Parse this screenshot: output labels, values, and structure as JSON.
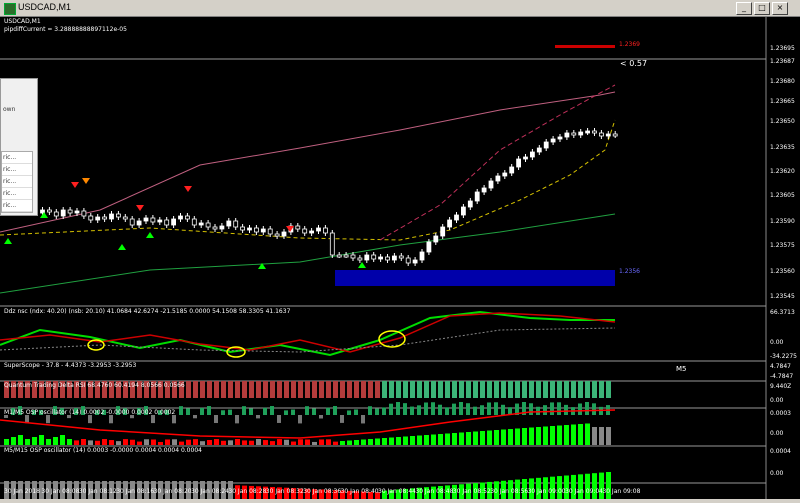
{
  "window": {
    "title": "USDCAD,M1",
    "buttons": [
      "_",
      "□",
      "×"
    ]
  },
  "chart_header": {
    "symbol": "USDCAD,M1",
    "pipdiff": "pipdiffCurrent = 3.28888888897112e-05"
  },
  "spread_readout": "< 0.57",
  "price_axis": [
    "1.23695",
    "1.23687",
    "1.23680",
    "1.23665",
    "1.23650",
    "1.23635",
    "1.23620",
    "1.23605",
    "1.23590",
    "1.23575",
    "1.23560",
    "1.23545"
  ],
  "level_boxes": {
    "top": "1.2369",
    "bottom": "1.2356"
  },
  "time_axis": [
    "30 Jan 2018",
    "30 Jan 08:08",
    "30 Jan 08:12",
    "30 Jan 08:16",
    "30 Jan 08:20",
    "30 Jan 08:24",
    "30 Jan 08:28",
    "30 Jan 08:32",
    "30 Jan 08:36",
    "30 Jan 08:40",
    "30 Jan 08:44",
    "30 Jan 08:48",
    "30 Jan 08:52",
    "30 Jan 08:56",
    "30 Jan 09:00",
    "30 Jan 09:04",
    "30 Jan 09:08"
  ],
  "panes": [
    {
      "title": "Ddz nsc (ndx: 40.20) (nsb: 20.10) 41.0684 42.6274 -21.5185 0.0000 54.1508 58.3305 41.1637",
      "ticks": [
        "66.3713",
        "0.00",
        "-34.2275"
      ]
    },
    {
      "title": "SuperScope - 37.8 - 4.4373 -3.2953 -3.2953",
      "tag": "M5",
      "ticks": [
        "4.7847",
        "-4.7847"
      ]
    },
    {
      "title": "Quantum Trading Delta RSI 68.4760 60.4194 8.0566 0.0566",
      "ticks": [
        "9.440Z",
        "0.00"
      ]
    },
    {
      "title": "M1/M5 OSP oscillator (14) 0.0002 -0.0000 0.0002 0.0002",
      "ticks": [
        "0.0003",
        "0.00"
      ]
    },
    {
      "title": "M5/M15 OSP oscillator (14) 0.0003 -0.0000 0.0004 0.0004 0.0004",
      "ticks": [
        "0.0004",
        "0.00"
      ]
    }
  ],
  "dialog": {
    "text": "own",
    "items": [
      "ric...",
      "ric...",
      "ric...",
      "ric...",
      "ric..."
    ]
  },
  "colors": {
    "bull": "#ffffff",
    "bear": "#000000",
    "green": "#00ff00",
    "red": "#ff0000",
    "blue": "#0000aa"
  }
}
